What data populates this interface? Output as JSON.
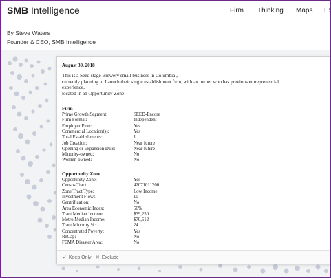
{
  "header": {
    "logo_bold": "SMB",
    "logo_rest": "Intelligence",
    "nav": [
      "Firm",
      "Thinking",
      "Maps",
      "Ex"
    ]
  },
  "byline": {
    "author": "By Steve Waters",
    "role": "Founder & CEO, SMB Intelligence"
  },
  "card": {
    "date": "August 30, 2018",
    "description": [
      "This is a Seed stage Brewery small business in Columbia ,",
      "currently planning to Launch their single establishment firm, with an owner who has previous entrepreneurial experience,",
      "located in an Opportunity Zone"
    ],
    "firm": {
      "title": "Firm",
      "rows": [
        {
          "k": "Prime Growth Segment:",
          "v": "SEED-Encore"
        },
        {
          "k": "Firm Format:",
          "v": "Independent"
        },
        {
          "k": "Employer Firm:",
          "v": "Yes"
        },
        {
          "k": "Commercial Location(s):",
          "v": "Yes"
        },
        {
          "k": "Total Establishments:",
          "v": "1"
        },
        {
          "k": "Job Creation:",
          "v": "Near future"
        },
        {
          "k": "Opening or Expansion Date:",
          "v": "Near future"
        },
        {
          "k": "Minority-owned:",
          "v": "No"
        },
        {
          "k": "Women-owned:",
          "v": "No"
        }
      ]
    },
    "oz": {
      "title": "Opportunity Zone",
      "rows": [
        {
          "k": "Opportunity Zone:",
          "v": "Yes"
        },
        {
          "k": "Census Tract:",
          "v": "42071011200"
        },
        {
          "k": "Zone Tract Type:",
          "v": "Low Income"
        },
        {
          "k": "Investment Flows:",
          "v": "10"
        },
        {
          "k": "Gentrification:",
          "v": "No"
        },
        {
          "k": "Area Economic Index:",
          "v": "56%"
        },
        {
          "k": "Tract Median Income:",
          "v": "$39,250"
        },
        {
          "k": "Metro Median Income:",
          "v": "$70,512"
        },
        {
          "k": "Tract Minority %:",
          "v": "24"
        },
        {
          "k": "Concentrated Poverty:",
          "v": "Yes"
        },
        {
          "k": "ReCap:",
          "v": "No"
        },
        {
          "k": "FEMA Disaster Area:",
          "v": "No"
        }
      ]
    },
    "footer": {
      "keep_label": "Keep Only",
      "keep_icon": "check-icon",
      "exclude_label": "Exclude",
      "exclude_icon": "x-icon"
    }
  },
  "colors": {
    "frame": "#6b2a86",
    "map_dots": "#c7ccd9",
    "map_bg": "#f1f3f4"
  }
}
